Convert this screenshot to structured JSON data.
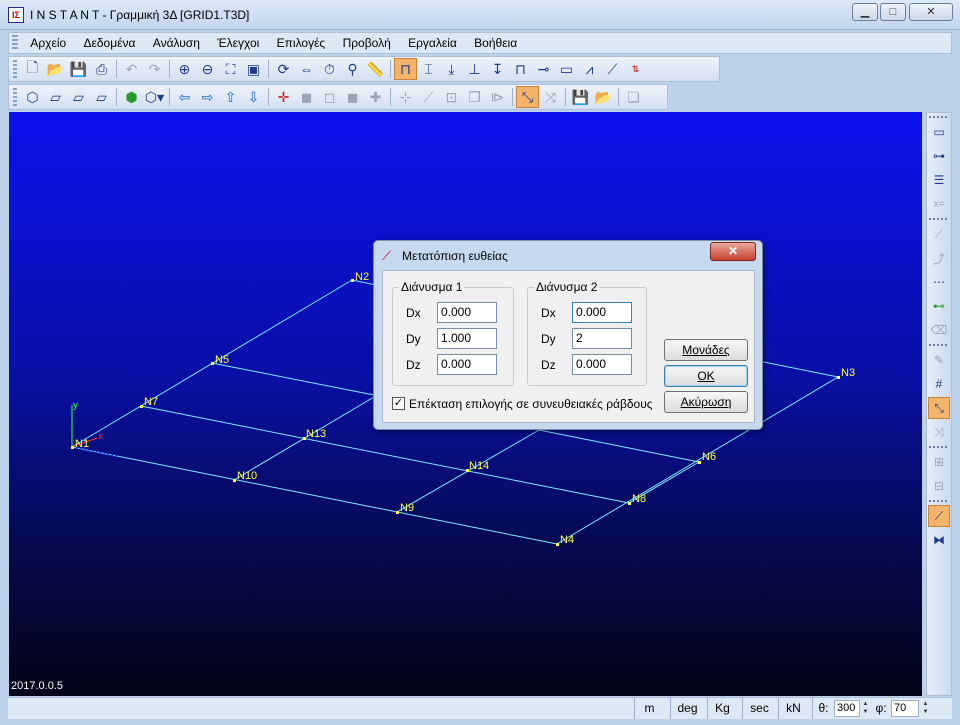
{
  "window": {
    "title": "I N S T A N T - Γραμμική 3Δ [GRID1.T3D]",
    "app_icon": "instant-app-icon",
    "minimize": "▁",
    "maximize": "□",
    "close": "✕"
  },
  "menu": [
    "Αρχείο",
    "Δεδομένα",
    "Ανάλυση",
    "Έλεγχοι",
    "Επιλογές",
    "Προβολή",
    "Εργαλεία",
    "Βοήθεια"
  ],
  "viewport": {
    "version": "2017.0.0.5",
    "axis_y": "y",
    "axis_x": "x",
    "nodes": {
      "N1": "N1",
      "N2": "N2",
      "N3": "N3",
      "N4": "N4",
      "N5": "N5",
      "N6": "N6",
      "N7": "N7",
      "N8": "N8",
      "N9": "N9",
      "N10": "N10",
      "N13": "N13",
      "N14": "N14"
    },
    "colors": {
      "grid_lines": "#7fe9ff",
      "node_labels": "#ffff40",
      "axis_y": "#40ff40",
      "axis_x": "#ff3030",
      "background_top": "#0c12ee",
      "background_bottom": "#040417"
    }
  },
  "dialog": {
    "title": "Μετατόπιση ευθείας",
    "close": "✕",
    "vector1": {
      "title": "Διάνυσμα 1",
      "dx_label": "Dx",
      "dx": "0.000",
      "dy_label": "Dy",
      "dy": "1.000",
      "dz_label": "Dz",
      "dz": "0.000"
    },
    "vector2": {
      "title": "Διάνυσμα 2",
      "dx_label": "Dx",
      "dx": "0.000",
      "dy_label": "Dy",
      "dy": "2",
      "dz_label": "Dz",
      "dz": "0.000"
    },
    "buttons": {
      "units": "Μονάδες",
      "ok": "OK",
      "cancel": "Ακύρωση"
    },
    "checkbox": {
      "label": "Επέκταση επιλογής σε συνευθειακές ράβδους",
      "checked": true
    }
  },
  "statusbar": {
    "length": "m",
    "angle": "deg",
    "mass": "Kg",
    "time": "sec",
    "force": "kN",
    "theta_label": "θ:",
    "theta": "300",
    "phi_label": "φ:",
    "phi": "70"
  }
}
